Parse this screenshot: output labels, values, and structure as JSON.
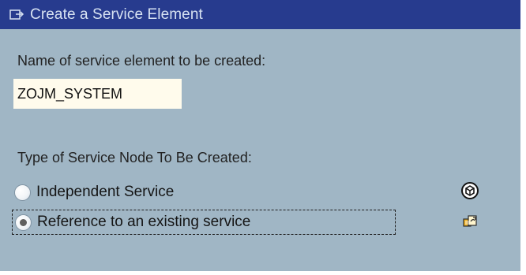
{
  "window": {
    "title": "Create a Service Element",
    "title_icon": "new-document-icon"
  },
  "form": {
    "name_label": "Name of service element to be created:",
    "name_value": "ZOJM_SYSTEM",
    "type_label": "Type of Service Node To Be Created:",
    "options": [
      {
        "label": "Independent Service",
        "selected": false,
        "icon": "service-cube-icon"
      },
      {
        "label": "Reference to an existing service",
        "selected": true,
        "icon": "reference-copy-icon"
      }
    ]
  },
  "colors": {
    "title_bar": "#273b8e",
    "panel": "#a0b6c5",
    "input_background": "#fffbec",
    "focus_border": "#1f1f1f"
  }
}
